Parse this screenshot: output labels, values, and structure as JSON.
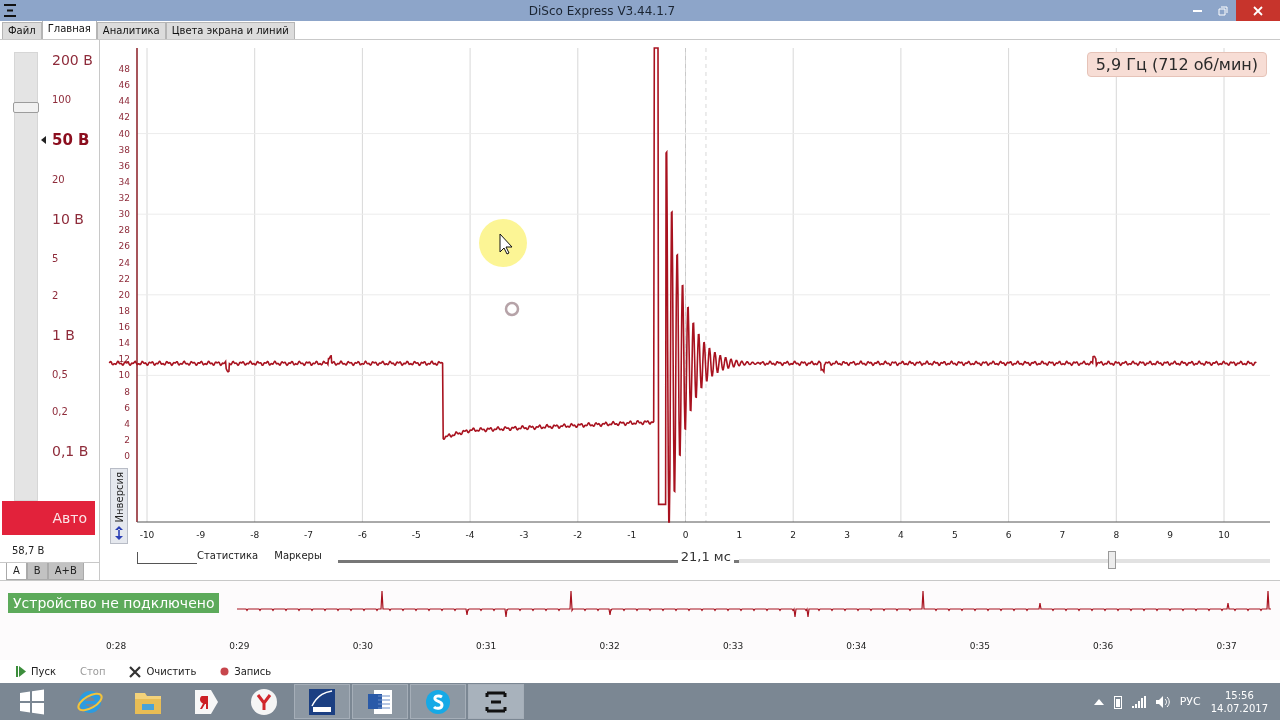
{
  "window": {
    "title": "DiSco Express V3.44.1.7"
  },
  "menu_tabs": [
    {
      "label": "Файл",
      "selected": false
    },
    {
      "label": "Главная",
      "selected": true
    },
    {
      "label": "Аналитика",
      "selected": false
    },
    {
      "label": "Цвета экрана и линий",
      "selected": false
    }
  ],
  "scale_panel": {
    "level": 0.89,
    "ranges": [
      {
        "label": "200 В",
        "kind": "major",
        "selected": false
      },
      {
        "label": "100",
        "kind": "minor",
        "selected": false
      },
      {
        "label": "50 В",
        "kind": "major",
        "selected": true
      },
      {
        "label": "20",
        "kind": "minor",
        "selected": false
      },
      {
        "label": "10 В",
        "kind": "major",
        "selected": false
      },
      {
        "label": "5",
        "kind": "minor",
        "selected": false
      },
      {
        "label": "2",
        "kind": "minor",
        "selected": false
      },
      {
        "label": "1 В",
        "kind": "major",
        "selected": false
      },
      {
        "label": "0,5",
        "kind": "minor",
        "selected": false
      },
      {
        "label": "0,2",
        "kind": "minor",
        "selected": false
      },
      {
        "label": "0,1 В",
        "kind": "major",
        "selected": false
      }
    ],
    "auto": {
      "label": "Авто",
      "on": true
    },
    "reading": "58,7 В",
    "channel_tabs": [
      {
        "label": "A",
        "selected": true
      },
      {
        "label": "B",
        "selected": false
      },
      {
        "label": "A+B",
        "selected": false
      }
    ]
  },
  "chart": {
    "y_tick_labels": [
      "48",
      "46",
      "44",
      "42",
      "40",
      "38",
      "36",
      "34",
      "32",
      "30",
      "28",
      "26",
      "24",
      "22",
      "20",
      "18",
      "16",
      "14",
      "12",
      "10",
      "8",
      "6",
      "4",
      "2",
      "0"
    ],
    "x_tick_labels": [
      "-10",
      "-9",
      "-8",
      "-7",
      "-6",
      "-5",
      "-4",
      "-3",
      "-2",
      "-1",
      "0",
      "1",
      "2",
      "3",
      "4",
      "5",
      "6",
      "7",
      "8",
      "9",
      "10"
    ],
    "frequency": "5,9 Гц (712 об/мин)",
    "inversion_button": "Инверсия",
    "bottom_tabs": [
      "Статистика",
      "Маркеры"
    ],
    "timebase": {
      "reading": "21,1 мс",
      "level": 0.83
    }
  },
  "overview": {
    "status": "Устройство не подключено",
    "time_labels": [
      "0:28",
      "0:29",
      "0:30",
      "0:31",
      "0:32",
      "0:33",
      "0:34",
      "0:35",
      "0:36",
      "0:37"
    ]
  },
  "controls": [
    {
      "label": "Пуск",
      "kind": "play",
      "disabled": false
    },
    {
      "label": "Стоп",
      "kind": "stop",
      "disabled": true
    },
    {
      "label": "Очистить",
      "kind": "clear",
      "disabled": false
    },
    {
      "label": "Запись",
      "kind": "record",
      "disabled": false
    }
  ],
  "taskbar": {
    "apps": [
      {
        "kind": "start",
        "running": false,
        "selected": false
      },
      {
        "kind": "browser-e",
        "running": false,
        "selected": false
      },
      {
        "kind": "folder",
        "running": false,
        "selected": false
      },
      {
        "kind": "letter-tag",
        "running": false,
        "selected": false
      },
      {
        "kind": "letter-circle",
        "running": false,
        "selected": false
      },
      {
        "kind": "pdf",
        "running": true,
        "selected": false
      },
      {
        "kind": "document",
        "running": true,
        "selected": false
      },
      {
        "kind": "chat",
        "running": true,
        "selected": false
      },
      {
        "kind": "app",
        "running": true,
        "selected": true
      }
    ],
    "language": "РУС",
    "time": "15:56",
    "date": "14.07.2017"
  }
}
